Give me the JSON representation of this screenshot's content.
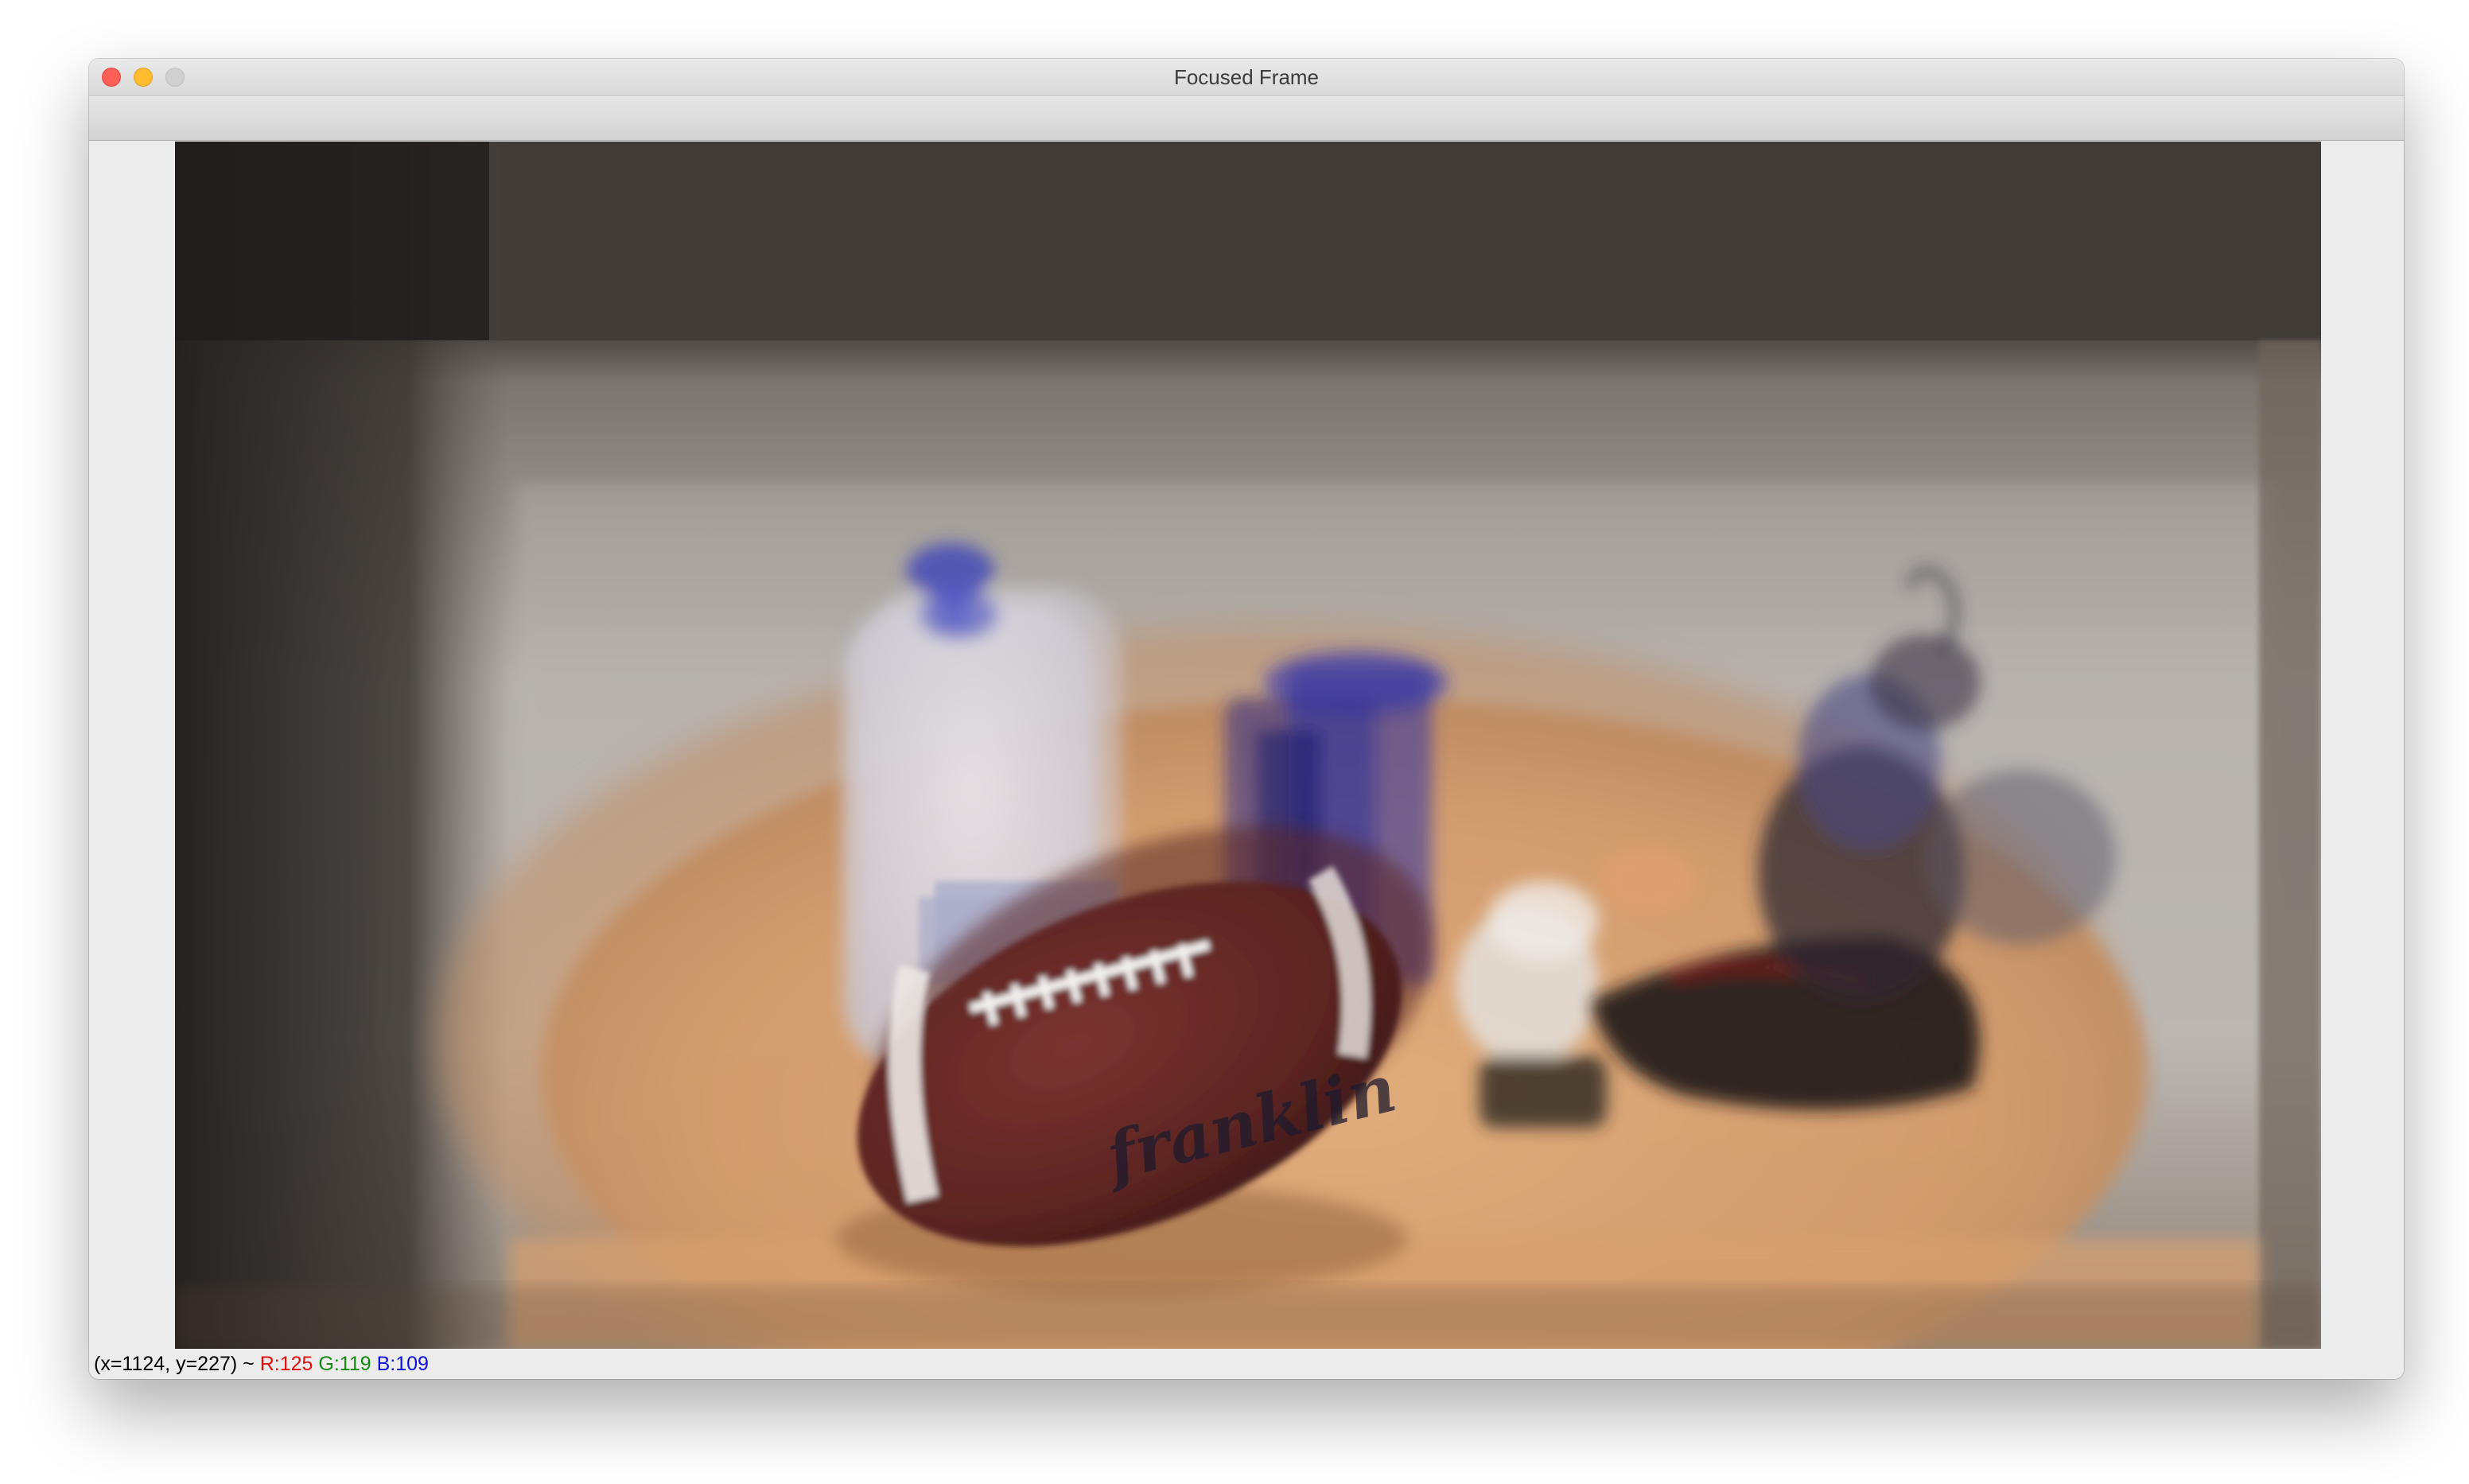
{
  "window": {
    "title": "Focused Frame",
    "controls": [
      "close-icon",
      "minimize-icon",
      "maximize-icon"
    ]
  },
  "status_bar": {
    "coords": "(x=1124, y=227) ~",
    "r": "R:125",
    "g": "G:119",
    "b": "B:109"
  },
  "image": {
    "football_text": "franklin"
  },
  "colors": {
    "close": "#fe5f57",
    "minimize": "#febc2e",
    "maximize": "#d0d0d0",
    "r_label": "#e01010",
    "g_label": "#138a13",
    "b_label": "#1010e0"
  }
}
